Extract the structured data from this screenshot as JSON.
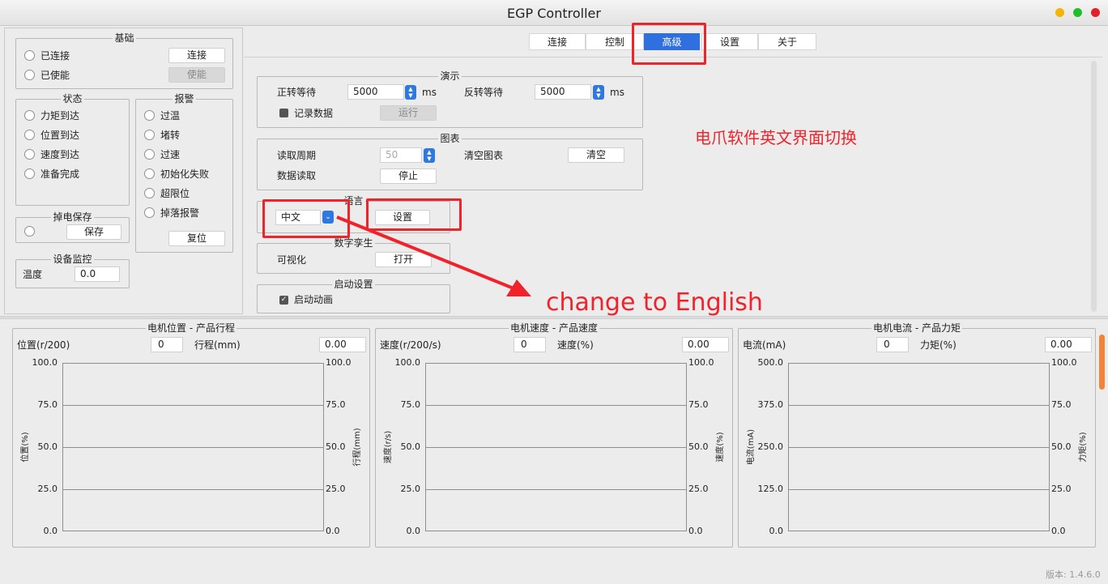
{
  "window": {
    "title": "EGP Controller"
  },
  "colors": {
    "accent": "#2f6fe0",
    "highlight": "#f0222a",
    "dot_yellow": "#f4b400",
    "dot_green": "#1fbf2a",
    "dot_red": "#e2202a"
  },
  "basic": {
    "title": "基础",
    "connected": "已连接",
    "enabled": "已使能",
    "connect_btn": "连接",
    "enable_btn": "使能"
  },
  "status": {
    "title": "状态",
    "items": [
      "力矩到达",
      "位置到达",
      "速度到达",
      "准备完成"
    ]
  },
  "alarm": {
    "title": "报警",
    "items": [
      "过温",
      "堵转",
      "过速",
      "初始化失败",
      "超限位",
      "掉落报警"
    ],
    "reset_btn": "复位"
  },
  "power_save": {
    "title": "掉电保存",
    "save_btn": "保存"
  },
  "monitor": {
    "title": "设备监控",
    "temp_label": "温度",
    "temp_value": "0.0"
  },
  "tabs": [
    "连接",
    "控制",
    "高级",
    "设置",
    "关于"
  ],
  "demo": {
    "title": "演示",
    "forward_wait_label": "正转等待",
    "forward_wait_value": "5000",
    "reverse_wait_label": "反转等待",
    "reverse_wait_value": "5000",
    "unit": "ms",
    "record_label": "记录数据",
    "run_btn": "运行"
  },
  "chart_settings": {
    "title": "图表",
    "period_label": "读取周期",
    "period_value": "50",
    "clear_label": "清空图表",
    "clear_btn": "清空",
    "read_label": "数据读取",
    "stop_btn": "停止"
  },
  "language": {
    "title": "语言",
    "selected": "中文",
    "set_btn": "设置"
  },
  "twin": {
    "title": "数字孪生",
    "visual_label": "可视化",
    "open_btn": "打开"
  },
  "startup": {
    "title": "启动设置",
    "anim_label": "启动动画"
  },
  "annotations": {
    "cn_note": "电爪软件英文界面切换",
    "en_note": "change to English"
  },
  "charts": [
    {
      "title": "电机位置 - 产品行程",
      "left_label": "位置(r/200)",
      "left_value": "0",
      "right_label": "行程(mm)",
      "right_value": "0.00",
      "yleft_label": "位置(%)",
      "yright_label": "行程(mm)",
      "left_ticks": [
        "100.0",
        "75.0",
        "50.0",
        "25.0",
        "0.0"
      ],
      "right_ticks": [
        "100.0",
        "75.0",
        "50.0",
        "25.0",
        "0.0"
      ]
    },
    {
      "title": "电机速度 - 产品速度",
      "left_label": "速度(r/200/s)",
      "left_value": "0",
      "right_label": "速度(%)",
      "right_value": "0.00",
      "yleft_label": "速度(r/s)",
      "yright_label": "速度(%)",
      "left_ticks": [
        "100.0",
        "75.0",
        "50.0",
        "25.0",
        "0.0"
      ],
      "right_ticks": [
        "100.0",
        "75.0",
        "50.0",
        "25.0",
        "0.0"
      ]
    },
    {
      "title": "电机电流 - 产品力矩",
      "left_label": "电流(mA)",
      "left_value": "0",
      "right_label": "力矩(%)",
      "right_value": "0.00",
      "yleft_label": "电流(mA)",
      "yright_label": "力矩(%)",
      "left_ticks": [
        "500.0",
        "375.0",
        "250.0",
        "125.0",
        "0.0"
      ],
      "right_ticks": [
        "100.0",
        "75.0",
        "50.0",
        "25.0",
        "0.0"
      ]
    }
  ],
  "version": "版本: 1.4.6.0"
}
